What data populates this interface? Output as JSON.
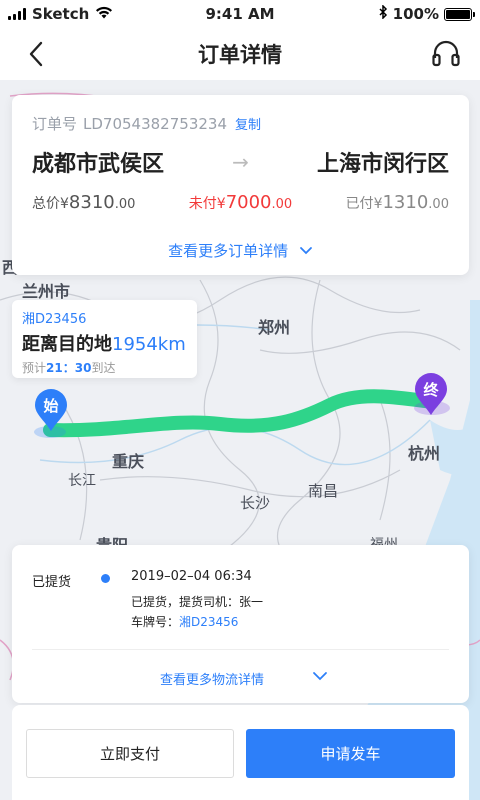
{
  "status_bar": {
    "carrier": "Sketch",
    "time": "9:41 AM",
    "battery": "100%"
  },
  "nav": {
    "title": "订单详情",
    "back_icon": "chevron-left-icon",
    "support_icon": "headset-icon"
  },
  "order": {
    "order_no_label": "订单号",
    "order_no": "LD7054382753234",
    "copy_label": "复制",
    "from_city": "成都市武侯区",
    "to_city": "上海市闵行区",
    "arrow": "→",
    "total_label": "总价",
    "currency": "¥",
    "total_int": "8310",
    "total_dec": ".00",
    "unpaid_label": "未付",
    "unpaid_int": "7000",
    "unpaid_dec": ".00",
    "paid_label": "已付",
    "paid_int": "1310",
    "paid_dec": ".00",
    "more_label": "查看更多订单详情"
  },
  "vehicle": {
    "plate": "湘D23456",
    "distance_label": "距离目的地",
    "distance_value": "1954km",
    "eta_prefix": "预计",
    "eta_hour": "21",
    "eta_sep": "：",
    "eta_min": "30",
    "eta_suffix": "到达"
  },
  "map": {
    "labels": {
      "lanzhou": "兰州市",
      "zhengzhou": "郑州",
      "chongqing": "重庆",
      "changjiang": "长江",
      "changsha": "长沙",
      "nanchang": "南昌",
      "hangzhou": "杭州",
      "guiyang": "贵阳",
      "west": "西",
      "fuzhou": "福州"
    },
    "start_marker": "始",
    "end_marker": "终",
    "route_color": "#2fd48a",
    "start_color": "#2d7ff9",
    "end_color": "#7b3fe0"
  },
  "logistics": {
    "status": "已提货",
    "time": "2019–02–04 06:34",
    "desc": "已提货，提货司机：张一",
    "plate_label": "车牌号：",
    "plate_value": "湘D23456",
    "more_label": "查看更多物流详情"
  },
  "actions": {
    "pay_label": "立即支付",
    "depart_label": "申请发车"
  },
  "colors": {
    "accent": "#2d7ff9",
    "danger": "#f23a3a"
  }
}
